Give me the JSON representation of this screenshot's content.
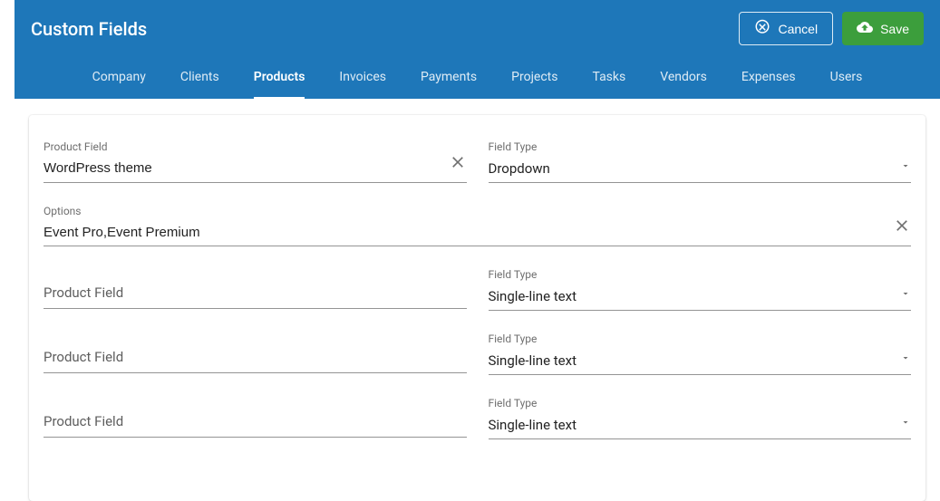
{
  "header": {
    "title": "Custom Fields",
    "cancel_label": "Cancel",
    "save_label": "Save"
  },
  "tabs": {
    "items": [
      {
        "label": "Company",
        "active": false
      },
      {
        "label": "Clients",
        "active": false
      },
      {
        "label": "Products",
        "active": true
      },
      {
        "label": "Invoices",
        "active": false
      },
      {
        "label": "Payments",
        "active": false
      },
      {
        "label": "Projects",
        "active": false
      },
      {
        "label": "Tasks",
        "active": false
      },
      {
        "label": "Vendors",
        "active": false
      },
      {
        "label": "Expenses",
        "active": false
      },
      {
        "label": "Users",
        "active": false
      }
    ]
  },
  "labels": {
    "product_field": "Product Field",
    "field_type": "Field Type",
    "options": "Options"
  },
  "field_type_options": {
    "dropdown": "Dropdown",
    "single_line": "Single-line text"
  },
  "rows": [
    {
      "product_field_value": "WordPress theme",
      "field_type_value": "Dropdown",
      "has_options": true,
      "options_value": "Event Pro,Event Premium"
    },
    {
      "product_field_value": "",
      "field_type_value": "Single-line text",
      "has_options": false
    },
    {
      "product_field_value": "",
      "field_type_value": "Single-line text",
      "has_options": false
    },
    {
      "product_field_value": "",
      "field_type_value": "Single-line text",
      "has_options": false
    }
  ]
}
